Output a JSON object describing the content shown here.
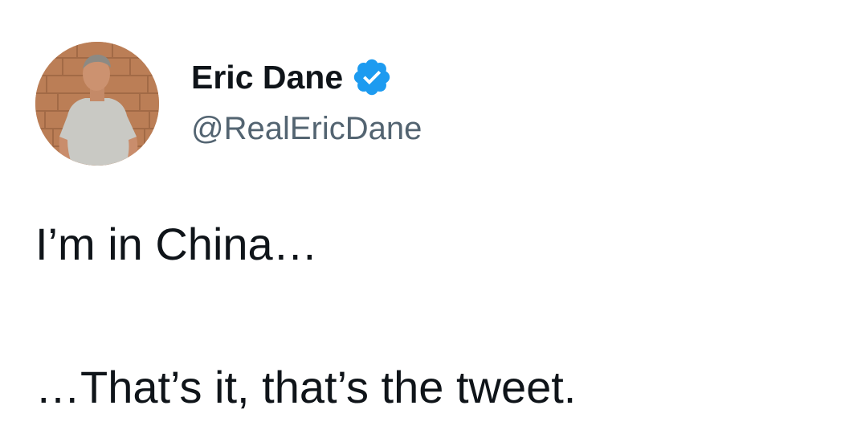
{
  "author": {
    "display_name": "Eric Dane",
    "handle": "@RealEricDane",
    "verified": true,
    "avatar_icon": "profile-photo",
    "verified_badge_icon": "verified-badge-icon"
  },
  "tweet": {
    "lines": [
      "I’m in China…",
      "…That’s it, that’s the tweet."
    ]
  },
  "colors": {
    "verified_badge": "#1d9bf0",
    "handle_text": "#536471",
    "body_text": "#0f1419",
    "background": "#ffffff"
  }
}
